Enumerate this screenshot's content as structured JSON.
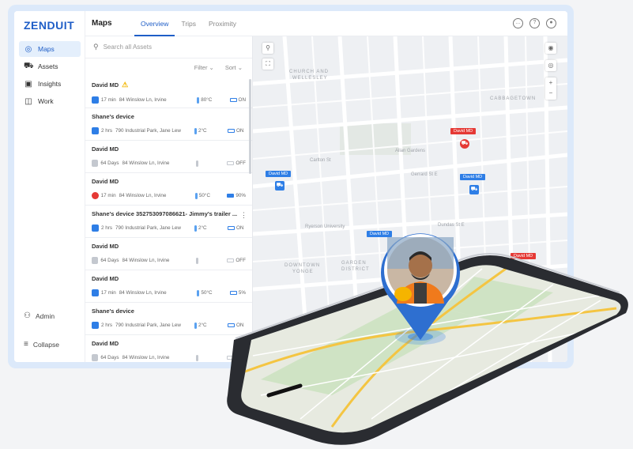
{
  "brand": {
    "logo": "ZENDUIT",
    "accent": "#1f5ec7"
  },
  "sidebar": {
    "items": [
      {
        "label": "Maps",
        "icon": "map-pin-icon",
        "active": true
      },
      {
        "label": "Assets",
        "icon": "car-icon",
        "active": false
      },
      {
        "label": "Insights",
        "icon": "chart-icon",
        "active": false
      },
      {
        "label": "Work",
        "icon": "briefcase-icon",
        "active": false
      }
    ],
    "admin": "Admin",
    "collapse": "Collapse"
  },
  "header": {
    "title": "Maps",
    "tabs": [
      "Overview",
      "Trips",
      "Proximity"
    ],
    "active_tab": "Overview"
  },
  "list": {
    "search_placeholder": "Search all Assets",
    "filter": "Filter",
    "sort": "Sort",
    "items": [
      {
        "name": "David MD",
        "warning": true,
        "time": "17 min",
        "address": "84 Winslow Ln, Irvine",
        "temp": "80°C",
        "status": "ON",
        "status_type": "blue"
      },
      {
        "name": "Shane's device",
        "warning": false,
        "time": "2 hrs",
        "address": "790 Industrial Park, Jane Lew",
        "temp": "2°C",
        "status": "ON",
        "status_type": "blue"
      },
      {
        "name": "David MD",
        "warning": false,
        "time": "64 Days",
        "address": "84 Winslow Ln, Irvine",
        "temp": "",
        "status": "OFF",
        "status_type": "grey"
      },
      {
        "name": "David MD",
        "warning": false,
        "time": "17 min",
        "address": "84 Winslow Ln, Irvine",
        "temp": "50°C",
        "status": "90%",
        "status_type": "red"
      },
      {
        "name": "Shane's device 352753097086621- Jimmy's trailer ...",
        "warning": false,
        "time": "2 hrs",
        "address": "790 Industrial Park, Jane Lew",
        "temp": "2°C",
        "status": "ON",
        "status_type": "blue"
      },
      {
        "name": "David MD",
        "warning": false,
        "time": "64 Days",
        "address": "84 Winslow Ln, Irvine",
        "temp": "",
        "status": "OFF",
        "status_type": "grey"
      },
      {
        "name": "David MD",
        "warning": false,
        "time": "17 min",
        "address": "84 Winslow Ln, Irvine",
        "temp": "50°C",
        "status": "5%",
        "status_type": "blue"
      },
      {
        "name": "Shane's device",
        "warning": false,
        "time": "2 hrs",
        "address": "790 Industrial Park, Jane Lew",
        "temp": "2°C",
        "status": "ON",
        "status_type": "blue"
      },
      {
        "name": "David MD",
        "warning": false,
        "time": "64 Days",
        "address": "84 Winslow Ln, Irvine",
        "temp": "",
        "status": "OFF",
        "status_type": "grey"
      }
    ]
  },
  "map": {
    "labels": {
      "church": "CHURCH AND",
      "wellesley": "WELLESLEY",
      "cabbagetown": "CABBAGETOWN",
      "garden": "GARDEN",
      "district": "DISTRICT",
      "downtown": "DOWNTOWN",
      "yonge": "YONGE",
      "ryerson": "Ryerson University",
      "allan": "Allan Gardens",
      "gerrard": "Gerrard St E",
      "dundas": "Dundas St E",
      "carlton": "Carlton St"
    },
    "pins": [
      {
        "label": "David MD",
        "type": "blue"
      },
      {
        "label": "David MD",
        "type": "red"
      },
      {
        "label": "David MD",
        "type": "blue"
      },
      {
        "label": "David MD",
        "type": "blue"
      },
      {
        "label": "David MD",
        "type": "red"
      }
    ]
  }
}
